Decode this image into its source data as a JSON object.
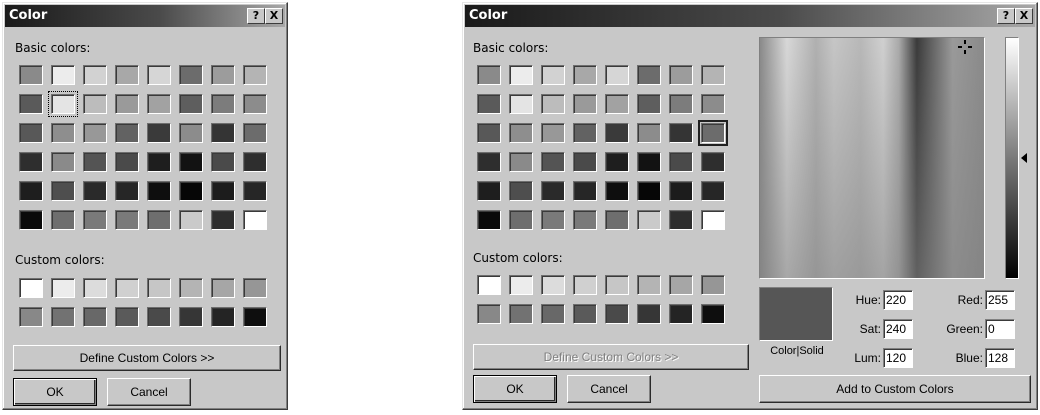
{
  "small_dialog": {
    "title": "Color",
    "help_label": "?",
    "close_label": "X",
    "basic_colors_label": "Basic colors:",
    "custom_colors_label": "Custom colors:",
    "define_button": "Define Custom Colors >>",
    "ok_button": "OK",
    "cancel_button": "Cancel",
    "basic_swatches": [
      "#8a8a8a",
      "#ececec",
      "#d2d2d2",
      "#a8a8a8",
      "#d6d6d6",
      "#6c6c6c",
      "#9c9c9c",
      "#b4b4b4",
      "#5a5a5a",
      "#e4e4e4",
      "#bcbcbc",
      "#9a9a9a",
      "#a2a2a2",
      "#5e5e5e",
      "#7c7c7c",
      "#8c8c8c",
      "#585858",
      "#8e8e8e",
      "#989898",
      "#626262",
      "#3a3a3a",
      "#8c8c8c",
      "#343434",
      "#6c6c6c",
      "#2e2e2e",
      "#8a8a8a",
      "#545454",
      "#4a4a4a",
      "#1e1e1e",
      "#121212",
      "#4a4a4a",
      "#2e2e2e",
      "#1e1e1e",
      "#4e4e4e",
      "#2a2a2a",
      "#262626",
      "#0e0e0e",
      "#060606",
      "#1c1c1c",
      "#262626",
      "#0a0a0a",
      "#6e6e6e",
      "#7a7a7a",
      "#7a7a7a",
      "#6e6e6e",
      "#cacaca",
      "#2e2e2e",
      "#ffffff"
    ],
    "custom_swatches": [
      "#ffffff",
      "#ececec",
      "#dcdcdc",
      "#d0d0d0",
      "#c6c6c6",
      "#b4b4b4",
      "#a6a6a6",
      "#969696",
      "#888888",
      "#727272",
      "#686868",
      "#5a5a5a",
      "#4a4a4a",
      "#363636",
      "#242424",
      "#0e0e0e"
    ]
  },
  "large_dialog": {
    "title": "Color",
    "help_label": "?",
    "close_label": "X",
    "basic_colors_label": "Basic colors:",
    "custom_colors_label": "Custom colors:",
    "define_button": "Define Custom Colors >>",
    "ok_button": "OK",
    "cancel_button": "Cancel",
    "color_solid_label": "Color|Solid",
    "add_button": "Add to Custom Colors",
    "preview_color": "#565656",
    "fields": {
      "hue_label": "Hue:",
      "hue": "220",
      "sat_label": "Sat:",
      "sat": "240",
      "lum_label": "Lum:",
      "lum": "120",
      "red_label": "Red:",
      "red": "255",
      "green_label": "Green:",
      "green": "0",
      "blue_label": "Blue:",
      "blue": "128"
    },
    "basic_swatches": [
      "#8a8a8a",
      "#ececec",
      "#d2d2d2",
      "#a8a8a8",
      "#d6d6d6",
      "#6c6c6c",
      "#9c9c9c",
      "#b4b4b4",
      "#5a5a5a",
      "#e4e4e4",
      "#bcbcbc",
      "#9a9a9a",
      "#a2a2a2",
      "#5e5e5e",
      "#7c7c7c",
      "#8c8c8c",
      "#585858",
      "#8e8e8e",
      "#989898",
      "#626262",
      "#3a3a3a",
      "#8c8c8c",
      "#343434",
      "#6c6c6c",
      "#2e2e2e",
      "#8a8a8a",
      "#545454",
      "#4a4a4a",
      "#1e1e1e",
      "#121212",
      "#4a4a4a",
      "#2e2e2e",
      "#1e1e1e",
      "#4e4e4e",
      "#2a2a2a",
      "#262626",
      "#0e0e0e",
      "#060606",
      "#1c1c1c",
      "#262626",
      "#0a0a0a",
      "#6e6e6e",
      "#7a7a7a",
      "#7a7a7a",
      "#6e6e6e",
      "#cacaca",
      "#2e2e2e",
      "#ffffff"
    ],
    "custom_swatches": [
      "#ffffff",
      "#ececec",
      "#dcdcdc",
      "#d0d0d0",
      "#c6c6c6",
      "#b4b4b4",
      "#a6a6a6",
      "#969696",
      "#888888",
      "#727272",
      "#686868",
      "#5a5a5a",
      "#4a4a4a",
      "#363636",
      "#242424",
      "#0e0e0e"
    ]
  }
}
